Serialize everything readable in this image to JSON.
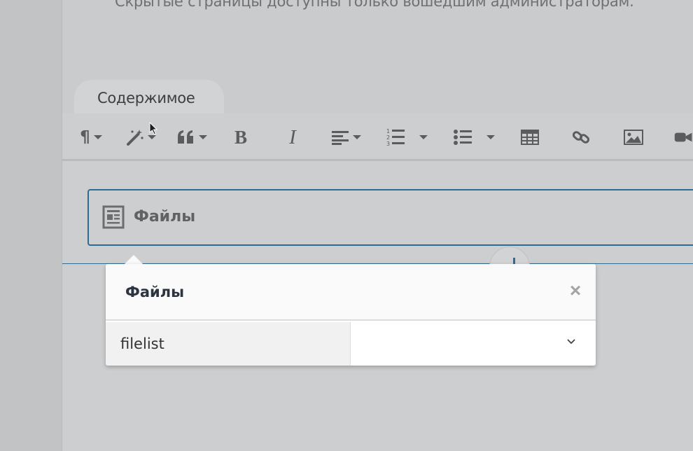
{
  "page": {
    "notice": "Скрытые страницы доступны только вошедшим администраторам."
  },
  "tab": {
    "label": "Содержимое"
  },
  "toolbar": {
    "paragraph": {
      "icon": "paragraph-icon",
      "glyph": "¶"
    },
    "magic": {
      "icon": "magic-wand-icon"
    },
    "quote": {
      "icon": "quote-icon"
    },
    "bold": {
      "icon": "bold-icon",
      "glyph": "B"
    },
    "italic": {
      "icon": "italic-icon",
      "glyph": "I"
    },
    "align": {
      "icon": "align-left-icon"
    },
    "ordered_list": {
      "icon": "ordered-list-icon"
    },
    "unordered_list": {
      "icon": "unordered-list-icon"
    },
    "table": {
      "icon": "table-icon"
    },
    "link": {
      "icon": "link-icon"
    },
    "image": {
      "icon": "image-icon"
    },
    "video": {
      "icon": "video-icon"
    }
  },
  "block": {
    "icon": "newspaper-icon",
    "title": "Файлы"
  },
  "popover": {
    "title": "Файлы",
    "close_icon": "close-icon",
    "close_glyph": "×",
    "field": {
      "label": "filelist",
      "value": "",
      "dropdown_icon": "chevron-down-icon"
    }
  },
  "colors": {
    "accent": "#2f6b93",
    "background": "#cacbcc",
    "icon": "#5a5c5e"
  }
}
